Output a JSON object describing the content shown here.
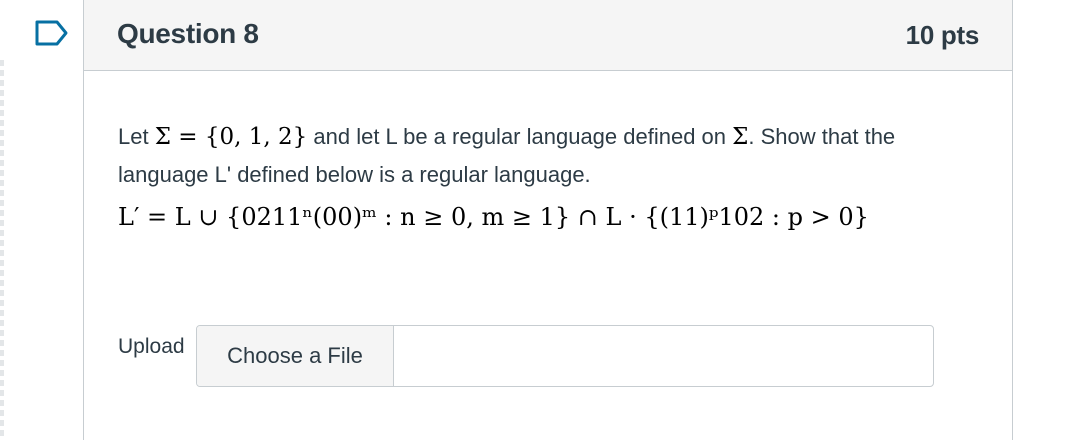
{
  "question": {
    "title": "Question 8",
    "points": "10 pts"
  },
  "prompt": {
    "line1_before": "Let ",
    "sigma_def": "Σ = {0, 1, 2}",
    "line1_middle": " and let L be a regular language defined on ",
    "sigma": "Σ",
    "line1_after": ". Show that the language L' defined below is a regular language."
  },
  "formula": {
    "text": "L′ = L ∪ {0211ⁿ(00)ᵐ : n ≥ 0, m ≥ 1} ∩ L · {(11)ᵖ102 : p > 0}"
  },
  "upload": {
    "label": "Upload",
    "button_label": "Choose a File"
  },
  "icons": {
    "flag": "flag-bookmark-icon"
  },
  "colors": {
    "accent": "#0770a3",
    "text": "#2d3b45",
    "border": "#c7cdd1",
    "header_bg": "#f5f5f5"
  }
}
